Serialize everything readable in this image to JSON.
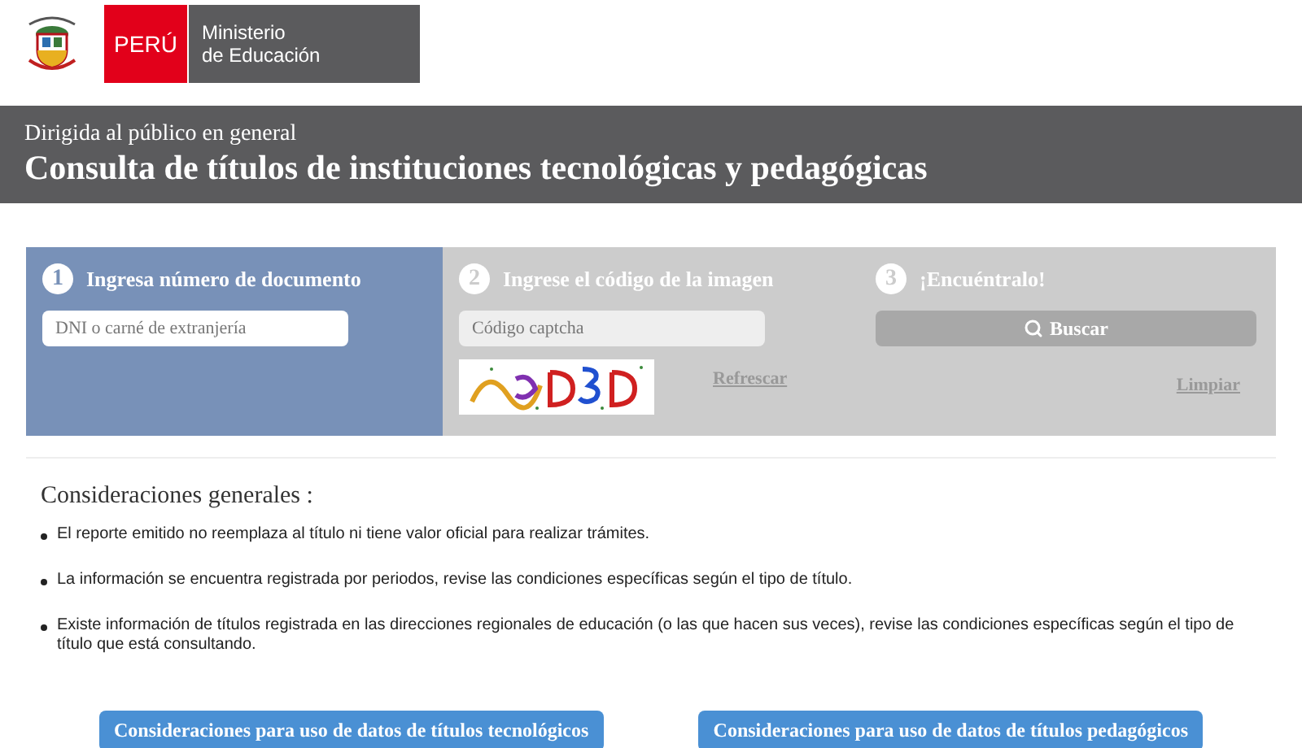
{
  "header": {
    "brand": "PERÚ",
    "ministry_line_1": "Ministerio",
    "ministry_line_2": "de Educación"
  },
  "banner": {
    "subtitle": "Dirigida al público en general",
    "title": "Consulta de títulos de instituciones tecnológicas y pedagógicas"
  },
  "steps": [
    {
      "kind": "document",
      "number": "1",
      "title": "Ingresa número de documento",
      "selected": true,
      "placeholder": "DNI o carné de extranjería"
    },
    {
      "kind": "captcha",
      "number": "2",
      "title": "Ingrese el código de la imagen",
      "selected": false,
      "placeholder": "Código captcha",
      "link": "Refrescar"
    },
    {
      "kind": "search",
      "number": "3",
      "title": "¡Encuéntralo!",
      "selected": false,
      "button": "Buscar",
      "link": "Limpiar"
    }
  ],
  "considerations": {
    "title": "Consideraciones generales :",
    "items": [
      "El reporte emitido no reemplaza al título ni tiene valor oficial para realizar trámites.",
      "La información se encuentra registrada por periodos, revise las condiciones específicas según el tipo de título.",
      "Existe información de títulos registrada en las direcciones regionales de educación (o las que hacen sus veces), revise las condiciones específicas según el tipo de título que está consultando."
    ]
  },
  "buttons": [
    "Consideraciones para uso de datos de títulos tecnológicos",
    "Consideraciones para uso de datos de títulos pedagógicos"
  ]
}
